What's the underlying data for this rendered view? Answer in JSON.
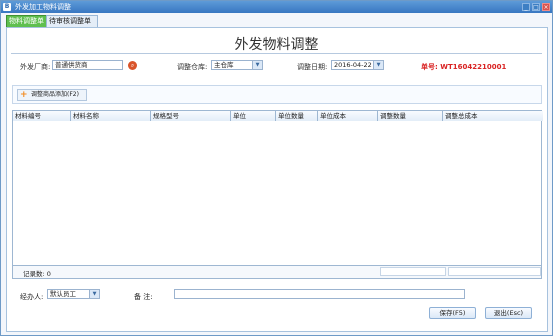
{
  "window": {
    "title": "外发加工物料调整",
    "icon_text": "B"
  },
  "tabs": [
    {
      "label": "物料调整单"
    },
    {
      "label": "待审核调整单"
    }
  ],
  "page_title": "外发物料调整",
  "form": {
    "supplier_label": "外发厂商:",
    "supplier_value": "普通供货商",
    "warehouse_label": "调整仓库:",
    "warehouse_value": "主仓库",
    "date_label": "调整日期:",
    "date_value": "2016-04-22",
    "order_no": "单号: WT16042210001"
  },
  "add_button_label": "调整商品添加(F2)",
  "table": {
    "columns": [
      "材料编号",
      "材料名称",
      "规格型号",
      "单位",
      "单位数量",
      "单位成本",
      "调整数量",
      "调整总成本"
    ]
  },
  "record_count": "记录数: 0",
  "bottom": {
    "handler_label": "经办人:",
    "handler_value": "默认员工",
    "remark_label": "备   注:",
    "remark_value": ""
  },
  "buttons": {
    "save": "保存(F5)",
    "exit": "退出(Esc)"
  },
  "colors": {
    "title_bar": "#3877c1",
    "active_tab": "#5fbf4e",
    "order_no": "#d92222"
  }
}
